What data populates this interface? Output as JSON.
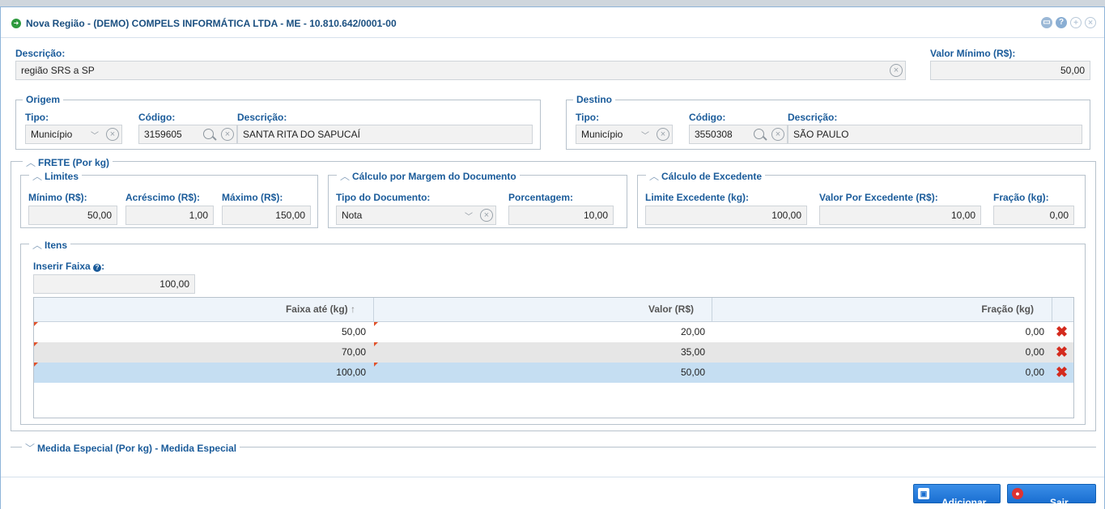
{
  "title": "Nova Região - (DEMO) COMPELS INFORMÁTICA LTDA - ME - 10.810.642/0001-00",
  "descricao_label": "Descrição:",
  "descricao_value": "região SRS a SP",
  "valor_minimo_label": "Valor Mínimo (R$):",
  "valor_minimo_value": "50,00",
  "origem": {
    "legend": "Origem",
    "tipo_label": "Tipo:",
    "tipo_value": "Município",
    "codigo_label": "Código:",
    "codigo_value": "3159605",
    "descricao_label": "Descrição:",
    "descricao_value": "SANTA RITA DO SAPUCAÍ"
  },
  "destino": {
    "legend": "Destino",
    "tipo_label": "Tipo:",
    "tipo_value": "Município",
    "codigo_label": "Código:",
    "codigo_value": "3550308",
    "descricao_label": "Descrição:",
    "descricao_value": "SÃO PAULO"
  },
  "frete": {
    "legend": "FRETE (Por kg)",
    "limites": {
      "legend": "Limites",
      "minimo_label": "Mínimo (R$):",
      "minimo_value": "50,00",
      "acrescimo_label": "Acréscimo (R$):",
      "acrescimo_value": "1,00",
      "maximo_label": "Máximo (R$):",
      "maximo_value": "150,00"
    },
    "margem": {
      "legend": "Cálculo por Margem do Documento",
      "tipo_label": "Tipo do Documento:",
      "tipo_value": "Nota",
      "porcentagem_label": "Porcentagem:",
      "porcentagem_value": "10,00"
    },
    "excedente": {
      "legend": "Cálculo de Excedente",
      "limite_label": "Limite Excedente (kg):",
      "limite_value": "100,00",
      "valor_label": "Valor Por Excedente (R$):",
      "valor_value": "10,00",
      "fracao_label": "Fração (kg):",
      "fracao_value": "0,00"
    },
    "itens": {
      "legend": "Itens",
      "inserir_label": "Inserir Faixa",
      "inserir_value": "100,00",
      "columns": [
        "Faixa até (kg)",
        "Valor (R$)",
        "Fração (kg)"
      ],
      "sort_indicator": "↑",
      "rows": [
        {
          "faixa": "50,00",
          "valor": "20,00",
          "fracao": "0,00"
        },
        {
          "faixa": "70,00",
          "valor": "35,00",
          "fracao": "0,00"
        },
        {
          "faixa": "100,00",
          "valor": "50,00",
          "fracao": "0,00"
        }
      ]
    }
  },
  "medida_especial_legend": "Medida Especial (Por kg) - Medida Especial",
  "buttons": {
    "adicionar": "Adicionar",
    "sair": "Sair"
  },
  "colors": {
    "accent": "#1a5b9a",
    "selected_row": "#c5def2",
    "alt_row": "#e6e6e6",
    "delete": "#d42b1e"
  },
  "icons": {
    "title": "add-circle-icon",
    "clear": "clear-circle-icon",
    "search": "magnifier-icon",
    "delete": "red-x-icon"
  }
}
